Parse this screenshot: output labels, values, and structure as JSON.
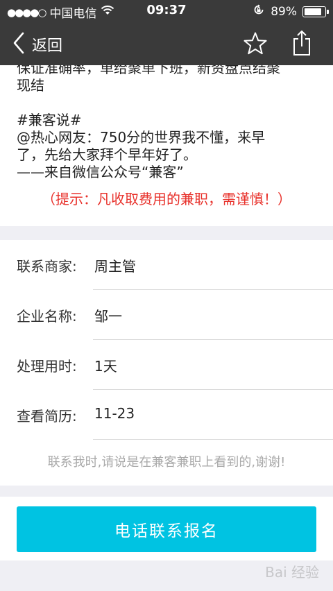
{
  "status_bar": {
    "signal": "●●●●○",
    "carrier": "中国电信",
    "time": "09:37",
    "battery_text": "89%",
    "battery_level": 0.89
  },
  "nav": {
    "back_label": "返回",
    "icons": [
      "chevron-left-icon",
      "star-outline-icon",
      "share-icon"
    ]
  },
  "description": {
    "lines_top": [
      "保证准确率，单给聚单下班，新资盘点结聚",
      "现结"
    ],
    "tag": "#兼客说#",
    "quote_lines": [
      "@热心网友：750分的世界我不懂，来早",
      "了，先给大家拜个早年好了。",
      "——来自微信公众号“兼客”"
    ],
    "warning": "（提示：凡收取费用的兼职，需谨慎！）"
  },
  "info": {
    "rows": [
      {
        "label": "联系商家:",
        "value": "周主管"
      },
      {
        "label": "企业名称:",
        "value": "邹一"
      },
      {
        "label": "处理用时:",
        "value": "1天"
      },
      {
        "label": "查看简历:",
        "value": "11-23"
      }
    ],
    "note": "联系我时,请说是在兼客兼职上看到的,谢谢!"
  },
  "action": {
    "call_button_label": "电话联系报名"
  },
  "watermark": "Bai 经验",
  "colors": {
    "bar_bg": "#3a3a3a",
    "accent": "#00c3e2",
    "warning": "#e8312b",
    "page_bg": "#efeff4"
  }
}
